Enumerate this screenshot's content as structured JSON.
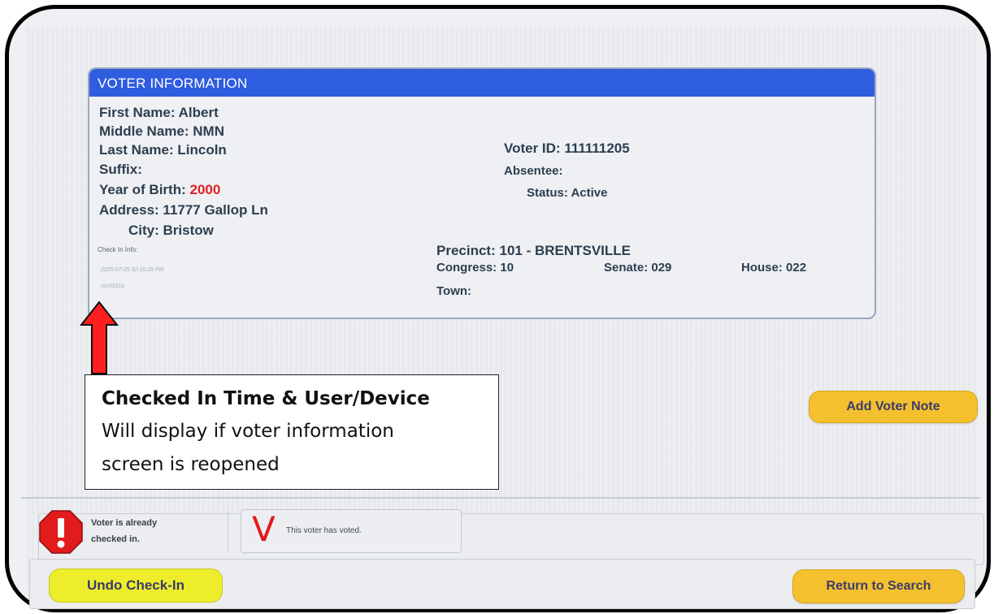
{
  "card": {
    "header": "VOTER INFORMATION",
    "first_name": {
      "label": "First Name:",
      "value": "Albert"
    },
    "middle_name": {
      "label": "Middle Name:",
      "value": "NMN"
    },
    "last_name": {
      "label": "Last Name:",
      "value": "Lincoln"
    },
    "suffix": {
      "label": "Suffix:",
      "value": ""
    },
    "year_of_birth": {
      "label": "Year of Birth:",
      "value": "2000"
    },
    "address": {
      "label": "Address:",
      "value": "11777 Gallop Ln"
    },
    "city": {
      "label": "City:",
      "value": "Bristow"
    },
    "check_in_info": {
      "label": "Check In Info:",
      "timestamp": "2025-07-25 02:16:28 PM",
      "user": "usr0101o"
    },
    "voter_id": {
      "label": "Voter ID:",
      "value": "111111205"
    },
    "absentee": {
      "label": "Absentee:",
      "value": ""
    },
    "status": {
      "label": "Status:",
      "value": "Active"
    },
    "precinct": {
      "label": "Precinct:",
      "value": "101 - BRENTSVILLE"
    },
    "congress": {
      "label": "Congress:",
      "value": "10"
    },
    "senate": {
      "label": "Senate:",
      "value": "029"
    },
    "house": {
      "label": "House:",
      "value": "022"
    },
    "town": {
      "label": "Town:",
      "value": ""
    }
  },
  "callout": {
    "title": "Checked In Time & User/Device",
    "line1": "Will display if voter information",
    "line2": "screen is reopened"
  },
  "buttons": {
    "add_voter_note": "Add Voter Note",
    "undo_check_in": "Undo Check-In",
    "return_to_search": "Return to Search"
  },
  "status": {
    "checked_in_line1": "Voter is already",
    "checked_in_line2": "checked in.",
    "voted_mark": "V",
    "voted_text": "This voter has voted."
  },
  "colors": {
    "header_blue": "#2f5de0",
    "button_amber": "#f4c02e",
    "button_yellow": "#eded2c",
    "alert_red": "#e02020"
  }
}
